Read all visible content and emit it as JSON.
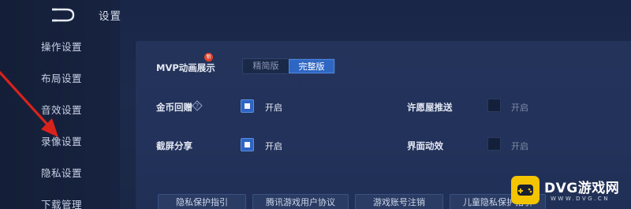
{
  "header": {
    "title": "设置"
  },
  "sidebar": {
    "items": [
      {
        "label": "操作设置"
      },
      {
        "label": "布局设置"
      },
      {
        "label": "音效设置"
      },
      {
        "label": "录像设置"
      },
      {
        "label": "隐私设置"
      },
      {
        "label": "下载管理"
      }
    ]
  },
  "mvp": {
    "label": "MVP动画展示",
    "badge": "新",
    "options": [
      "精简版",
      "完整版"
    ],
    "selected": "完整版"
  },
  "settings": [
    {
      "label": "金币回赠",
      "checkbox_label": "开启",
      "checked": true
    },
    {
      "label": "截屏分享",
      "checkbox_label": "开启",
      "checked": true
    },
    {
      "label": "许愿屋推送",
      "checkbox_label": "开启",
      "checked": false
    },
    {
      "label": "界面动效",
      "checkbox_label": "开启",
      "checked": false
    }
  ],
  "bottom_buttons": [
    {
      "label": "隐私保护指引"
    },
    {
      "label": "腾讯游戏用户协议"
    },
    {
      "label": "游戏账号注销"
    },
    {
      "label": "儿童隐私保护指引"
    }
  ],
  "watermark": {
    "title": "DVG游戏网",
    "url": "WWW.DVG.CN"
  },
  "colors": {
    "accent": "#2e66c4",
    "background": "#1d2a4b",
    "badge": "#e3412a",
    "annotation_arrow": "#d8231c"
  }
}
